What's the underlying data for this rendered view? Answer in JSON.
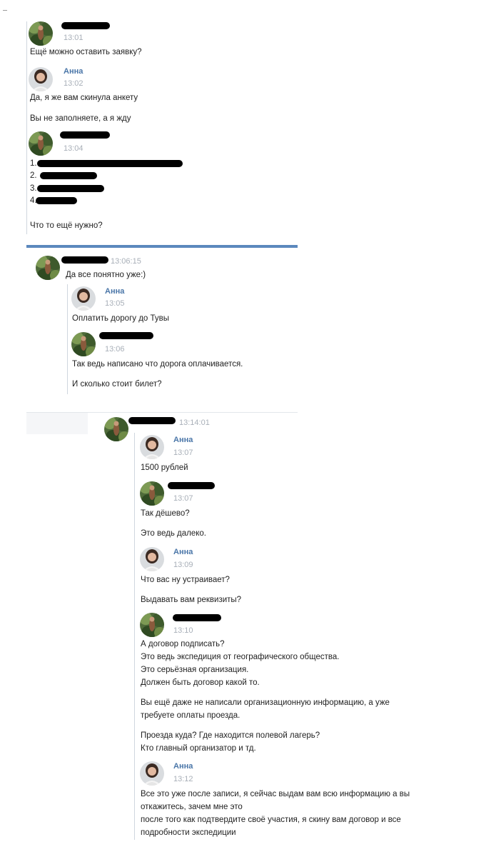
{
  "names": {
    "anna": "Анна"
  },
  "times": {
    "t1": "13:01",
    "t2": "13:02",
    "t3": "13:04",
    "fwd1": "13:06:15",
    "t5": "13:05",
    "t6": "13:06",
    "fwd2": "13:14:01",
    "t7": "13:07",
    "t8": "13:07",
    "t9": "13:09",
    "t10": "13:10",
    "t12": "13:12"
  },
  "messages": {
    "m1": "Ещё можно оставить заявку?",
    "m2": "Да, я же вам скинула анкету",
    "m3": "Вы не заполняете, а я жду",
    "list1": "1.",
    "list2": "2.",
    "list3": "3.",
    "list4": "4.",
    "m4": "Что то ещё нужно?",
    "m5": "Да все понятно уже:)",
    "m6": "Оплатить дорогу до Тувы",
    "m7": "Так ведь написано что дорога оплачивается.",
    "m8": "И сколько стоит билет?",
    "m9": "1500 рублей",
    "m10": "Так дёшево?",
    "m11": "Это ведь далеко.",
    "m12": "Что вас ну устраивает?",
    "m13": "Выдавать вам реквизиты?",
    "m14a": "А договор подписать?",
    "m14b": "Это ведь экспедиция от географического общества.",
    "m14c": "Это серьёзная организация.",
    "m14d": "Должен быть договор какой то.",
    "m15a": "Вы ещё даже не написали организационную информацию, а уже",
    "m15b": "требуете оплаты проезда.",
    "m16a": "Проезда куда? Где находится полевой лагерь?",
    "m16b": "Кто главный организатор и тд.",
    "m17a": "Все это уже после записи, я сейчас выдам вам всю информацию а вы",
    "m17b": "откажитесь, зачем мне это",
    "m17c": "после того как подтвердите своё участия, я скину вам договор и все",
    "m17d": "подробности экспедиции"
  },
  "icons": {
    "user_avatar": "forest-avatar-icon",
    "anna_avatar": "woman-avatar-icon"
  },
  "colors": {
    "link_blue": "#4a76a8",
    "divider_blue": "#5b88bd",
    "time_gray": "#a8afb8"
  }
}
